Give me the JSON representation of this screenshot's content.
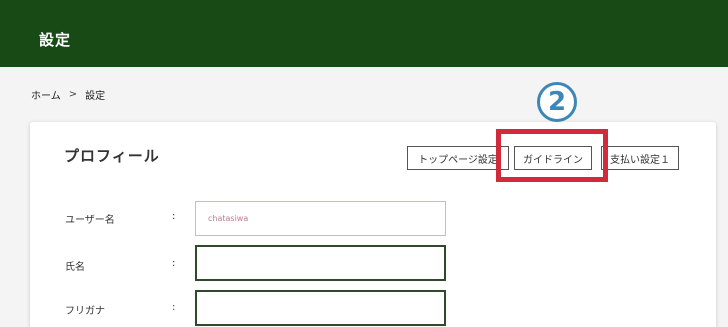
{
  "header": {
    "title": "設定"
  },
  "breadcrumb": {
    "home": "ホーム",
    "separator": ">",
    "current": "設定"
  },
  "profile": {
    "title": "プロフィール",
    "tabs": [
      {
        "label": "トップページ設定"
      },
      {
        "label": "ガイドライン"
      },
      {
        "label": "支払い設定１"
      }
    ],
    "fields": [
      {
        "label": "ユーザー名",
        "colon": ":",
        "value": "chatasiwa",
        "readonly": true
      },
      {
        "label": "氏名",
        "colon": ":",
        "value": ""
      },
      {
        "label": "フリガナ",
        "colon": ":",
        "value": ""
      }
    ]
  },
  "annotation": {
    "step_number": "2"
  },
  "colors": {
    "header_bg": "#174a14",
    "highlight_border": "#d12a3c",
    "step_marker": "#3d86b8",
    "field_border": "#2f4a2b"
  }
}
